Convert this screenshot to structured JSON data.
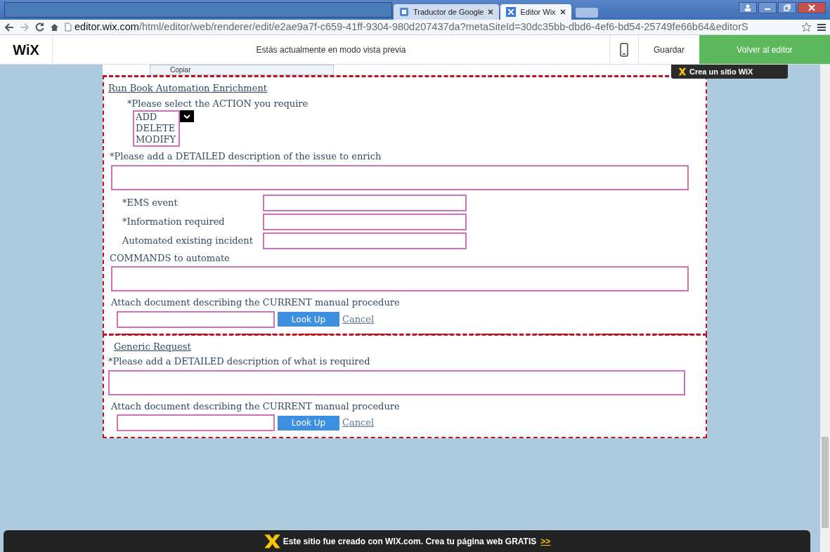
{
  "browser": {
    "tabs": [
      {
        "kind": "redacted",
        "selected": false
      },
      {
        "kind": "tab",
        "label": "Traductor de Google",
        "selected": false
      },
      {
        "kind": "tab",
        "label": "Editor Wix",
        "selected": true
      }
    ],
    "url_host": "editor.wix.com",
    "url_path": "/html/editor/web/renderer/edit/e2ae9a7f-c659-41ff-9304-980d207437da?metaSiteId=30dc35bb-dbd6-4ef6-bd54-25749fe66b64&editorS"
  },
  "wix_bar": {
    "logo": "WiX",
    "notice": "Estás actualmente en modo vista previa",
    "save": "Guardar",
    "back": "Volver al editor"
  },
  "tooltip": "Copiar",
  "promo_badge": "Crea un sitio WiX",
  "sections": [
    {
      "title": "Run Book Automation Enrichment",
      "fields": [
        {
          "kind": "listbox",
          "label": "*Please select the ACTION you require",
          "options": [
            "ADD",
            "DELETE",
            "MODIFY"
          ]
        },
        {
          "kind": "textarea",
          "label": "*Please add a DETAILED description of the issue to enrich"
        },
        {
          "kind": "inline",
          "label": "*EMS event"
        },
        {
          "kind": "inline",
          "label": "*Information required"
        },
        {
          "kind": "inline",
          "label": "Automated existing incident"
        },
        {
          "kind": "textarea",
          "label": "COMMANDS to automate"
        },
        {
          "kind": "upload",
          "label": "Attach document describing the CURRENT manual procedure",
          "button": "Look Up",
          "link": "Cancel"
        }
      ]
    },
    {
      "title": "Generic Request",
      "fields": [
        {
          "kind": "textarea",
          "label": "*Please add a DETAILED description of what is required"
        },
        {
          "kind": "upload",
          "label": "Attach document describing the CURRENT manual procedure",
          "button": "Look Up",
          "link": "Cancel"
        }
      ]
    }
  ],
  "footer": {
    "text": "Este sitio fue creado con WIX.com. Crea tu página web GRATIS",
    "link": ">>"
  }
}
